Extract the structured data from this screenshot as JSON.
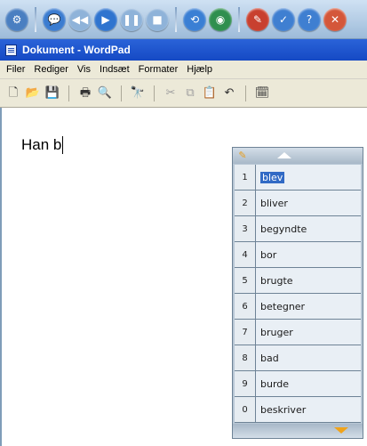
{
  "toolbar_top": {
    "buttons": [
      {
        "name": "settings-icon",
        "glyph": "⚙",
        "color": "#4a7fc1"
      },
      {
        "name": "speech-bubble-icon",
        "glyph": "💬",
        "color": "#3b7cd0"
      },
      {
        "name": "rewind-icon",
        "glyph": "◀◀",
        "color": "#8fb3d9"
      },
      {
        "name": "play-icon",
        "glyph": "▶",
        "color": "#2f74cf"
      },
      {
        "name": "pause-icon",
        "glyph": "❚❚",
        "color": "#8fb3d9"
      },
      {
        "name": "stop-icon",
        "glyph": "■",
        "color": "#8fb3d9"
      },
      {
        "name": "read-page-icon",
        "glyph": "⟲",
        "color": "#3a7fd4"
      },
      {
        "name": "web-icon",
        "glyph": "◉",
        "color": "#2f8f4f"
      },
      {
        "name": "prediction-icon",
        "glyph": "✎",
        "color": "#c8402f"
      },
      {
        "name": "spell-icon",
        "glyph": "✓",
        "color": "#3f7fd1"
      },
      {
        "name": "help-icon",
        "glyph": "?",
        "color": "#3f7fd1"
      },
      {
        "name": "close-icon",
        "glyph": "✕",
        "color": "#d4573a"
      }
    ]
  },
  "window": {
    "title": "Dokument - WordPad"
  },
  "menu": {
    "items": [
      "Filer",
      "Rediger",
      "Vis",
      "Indsæt",
      "Formater",
      "Hjælp"
    ]
  },
  "std_toolbar": {
    "buttons": [
      {
        "name": "new-document-icon",
        "glyph": "🗋",
        "dim": false
      },
      {
        "name": "open-folder-icon",
        "glyph": "📂",
        "dim": false
      },
      {
        "name": "save-icon",
        "glyph": "💾",
        "dim": false
      },
      {
        "name": "sep",
        "glyph": "",
        "dim": false
      },
      {
        "name": "print-icon",
        "glyph": "🖶",
        "dim": false
      },
      {
        "name": "print-preview-icon",
        "glyph": "🔍",
        "dim": false
      },
      {
        "name": "sep",
        "glyph": "",
        "dim": false
      },
      {
        "name": "find-icon",
        "glyph": "🔭",
        "dim": false
      },
      {
        "name": "sep",
        "glyph": "",
        "dim": false
      },
      {
        "name": "cut-icon",
        "glyph": "✂",
        "dim": true
      },
      {
        "name": "copy-icon",
        "glyph": "⧉",
        "dim": true
      },
      {
        "name": "paste-icon",
        "glyph": "📋",
        "dim": false
      },
      {
        "name": "undo-icon",
        "glyph": "↶",
        "dim": false
      },
      {
        "name": "sep",
        "glyph": "",
        "dim": false
      },
      {
        "name": "date-time-icon",
        "glyph": "🗓",
        "dim": false
      }
    ]
  },
  "document": {
    "text": "Han b"
  },
  "prediction": {
    "words": [
      {
        "num": "1",
        "word": "blev",
        "selected": true
      },
      {
        "num": "2",
        "word": "bliver",
        "selected": false
      },
      {
        "num": "3",
        "word": "begyndte",
        "selected": false
      },
      {
        "num": "4",
        "word": "bor",
        "selected": false
      },
      {
        "num": "5",
        "word": "brugte",
        "selected": false
      },
      {
        "num": "6",
        "word": "betegner",
        "selected": false
      },
      {
        "num": "7",
        "word": "bruger",
        "selected": false
      },
      {
        "num": "8",
        "word": "bad",
        "selected": false
      },
      {
        "num": "9",
        "word": "burde",
        "selected": false
      },
      {
        "num": "0",
        "word": "beskriver",
        "selected": false
      }
    ]
  }
}
